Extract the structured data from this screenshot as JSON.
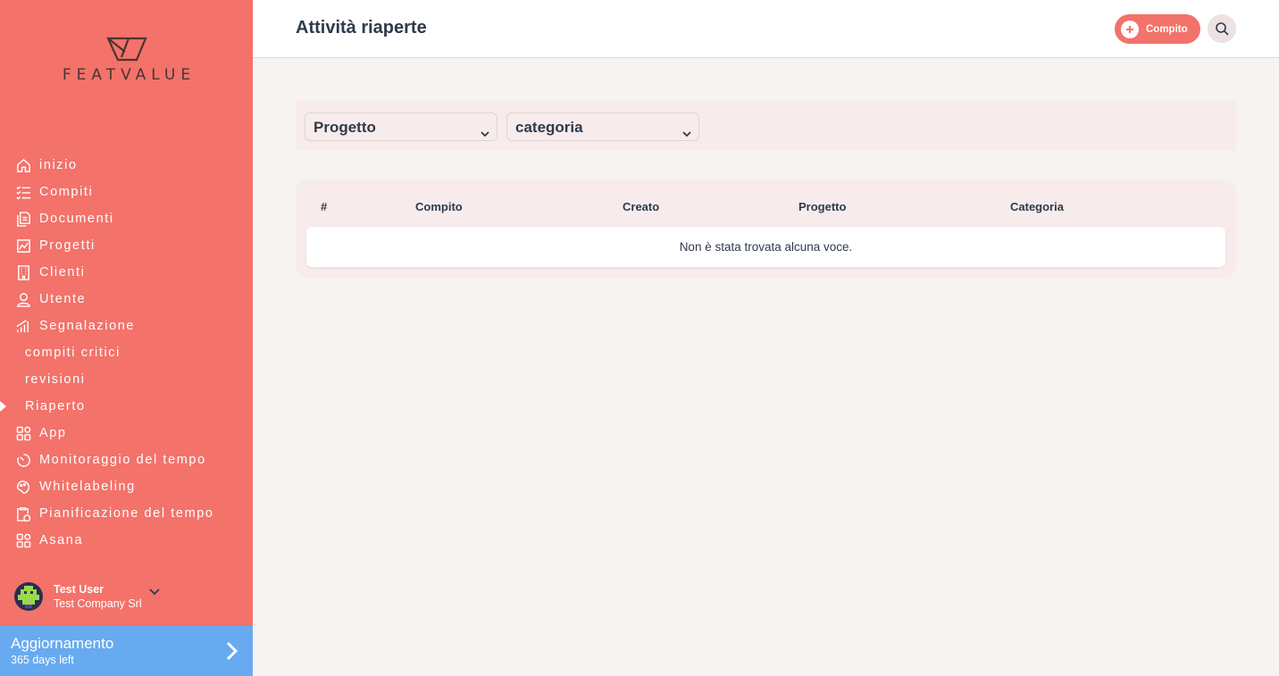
{
  "brand": {
    "name": "FEATVALUE"
  },
  "sidebar": {
    "items": [
      {
        "label": "inizio",
        "icon": "home-icon"
      },
      {
        "label": "Compiti",
        "icon": "checklist-icon"
      },
      {
        "label": "Documenti",
        "icon": "document-icon"
      },
      {
        "label": "Progetti",
        "icon": "chart-icon"
      },
      {
        "label": "Clienti",
        "icon": "building-icon"
      },
      {
        "label": "Utente",
        "icon": "user-icon"
      },
      {
        "label": "Segnalazione",
        "icon": "bar-signal-icon"
      },
      {
        "label": "compiti critici"
      },
      {
        "label": "revisioni"
      },
      {
        "label": "Riaperto",
        "active": true
      },
      {
        "label": "App",
        "icon": "apps-icon"
      },
      {
        "label": "Monitoraggio del tempo",
        "icon": "timer-icon"
      },
      {
        "label": "Whitelabeling",
        "icon": "palette-icon"
      },
      {
        "label": "Pianificazione del tempo",
        "icon": "clipboard-clock-icon"
      },
      {
        "label": "Asana",
        "icon": "apps-icon"
      }
    ],
    "user": {
      "name": "Test User",
      "company": "Test Company Srl"
    },
    "upgrade": {
      "title": "Aggiornamento",
      "subtitle": "365 days left"
    }
  },
  "header": {
    "title": "Attività riaperte",
    "add_button_label": "Compito"
  },
  "filters": {
    "project": "Progetto",
    "category": "categoria"
  },
  "table": {
    "columns": [
      "#",
      "Compito",
      "Creato",
      "Progetto",
      "Categoria"
    ],
    "empty_message": "Non è stata trovata alcuna voce."
  },
  "colors": {
    "sidebar": "#f3726a",
    "upgrade": "#67aaf0",
    "text_dark": "#2f3a4b",
    "panel": "#f7eceb"
  }
}
